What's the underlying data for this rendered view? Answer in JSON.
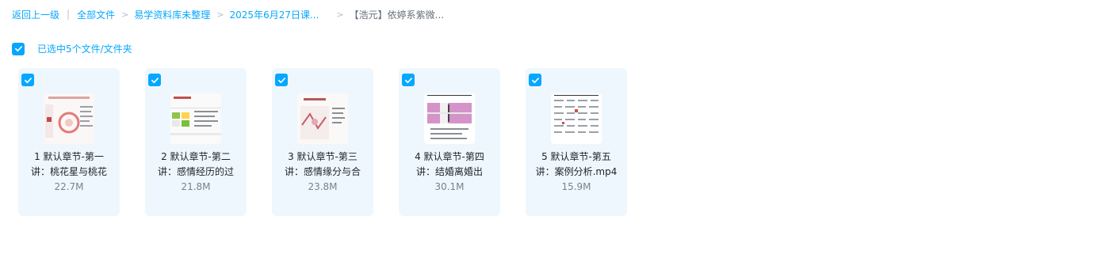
{
  "breadcrumb": {
    "back": "返回上一级",
    "separator": "|",
    "items": [
      "全部文件",
      "易学资料库未整理",
      "2025年6月27日课..."
    ],
    "arrow": ">",
    "current": "【浩元】依婷系紫微..."
  },
  "selection": {
    "label": "已选中5个文件/文件夹"
  },
  "files": [
    {
      "name": "1 默认章节-第一讲：桃花星与桃花",
      "size": "22.7M"
    },
    {
      "name": "2 默认章节-第二讲：感情经历的过",
      "size": "21.8M"
    },
    {
      "name": "3 默认章节-第三讲：感情缘分与合",
      "size": "23.8M"
    },
    {
      "name": "4 默认章节-第四讲：结婚离婚出",
      "size": "30.1M"
    },
    {
      "name": "5 默认章节-第五讲：案例分析.mp4",
      "size": "15.9M"
    }
  ],
  "colors": {
    "accent": "#06a7ff",
    "card_bg": "#eef7fe",
    "muted_text": "#7a8190"
  },
  "icons": {
    "checkbox": "checkmark-icon",
    "arrow": "chevron-right-icon"
  }
}
